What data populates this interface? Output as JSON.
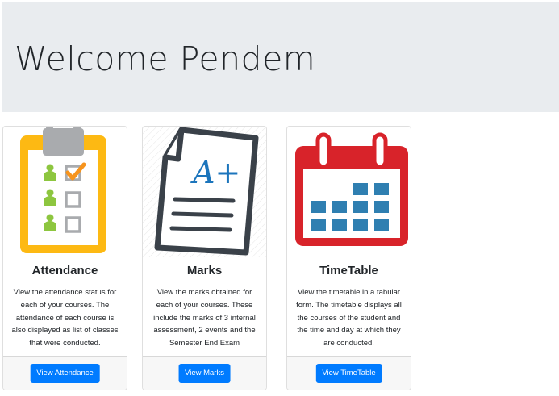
{
  "header": {
    "title": "Welcome Pendem"
  },
  "cards": [
    {
      "title": "Attendance",
      "text": "View the attendance status for each of your courses. The attendance of each course is also displayed as list of classes that were conducted.",
      "button": "View Attendance",
      "icon": "attendance-checklist-icon"
    },
    {
      "title": "Marks",
      "text": "View the marks obtained for each of your courses. These include the marks of 3 internal assessment, 2 events and the Semester End Exam",
      "button": "View Marks",
      "icon": "marks-paper-icon",
      "icon_text": "A+"
    },
    {
      "title": "TimeTable",
      "text": "View the timetable in a tabular form. The timetable displays all the courses of the student and the time and day at which they are conducted.",
      "button": "View TimeTable",
      "icon": "calendar-icon"
    }
  ],
  "colors": {
    "jumbotron": "#e9ecef",
    "primary": "#007bff",
    "attendance_frame": "#fdb913",
    "check_green": "#8dc63f",
    "check_orange": "#f7941d",
    "calendar_red": "#d8232a",
    "calendar_blue": "#2f7fb1",
    "paper_outline": "#3a4149",
    "paper_text_blue": "#1c75bc"
  }
}
